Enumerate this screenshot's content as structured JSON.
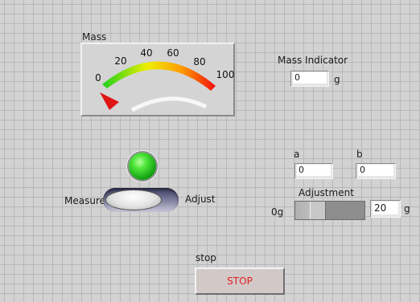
{
  "gauge": {
    "label": "Mass",
    "min": 0,
    "max": 100,
    "value": 0,
    "ticks": [
      "0",
      "20",
      "40",
      "60",
      "80",
      "100"
    ],
    "colors": {
      "low": "#2bd42b",
      "mid": "#f2f200",
      "high": "#ef1010",
      "needle": "#e01515"
    }
  },
  "mass_indicator": {
    "label": "Mass Indicator",
    "value": "0",
    "unit": "g"
  },
  "led": {
    "state": "on",
    "color": "#2ed52a"
  },
  "mode_switch": {
    "left_label": "Measure",
    "right_label": "Adjust",
    "position": "left"
  },
  "a_field": {
    "label": "a",
    "value": "0"
  },
  "b_field": {
    "label": "b",
    "value": "0"
  },
  "adjustment": {
    "label": "Adjustment",
    "min_label": "0g",
    "fraction": 0.33,
    "value": "20",
    "unit": "g"
  },
  "stop": {
    "label": "stop",
    "button_text": "STOP"
  }
}
